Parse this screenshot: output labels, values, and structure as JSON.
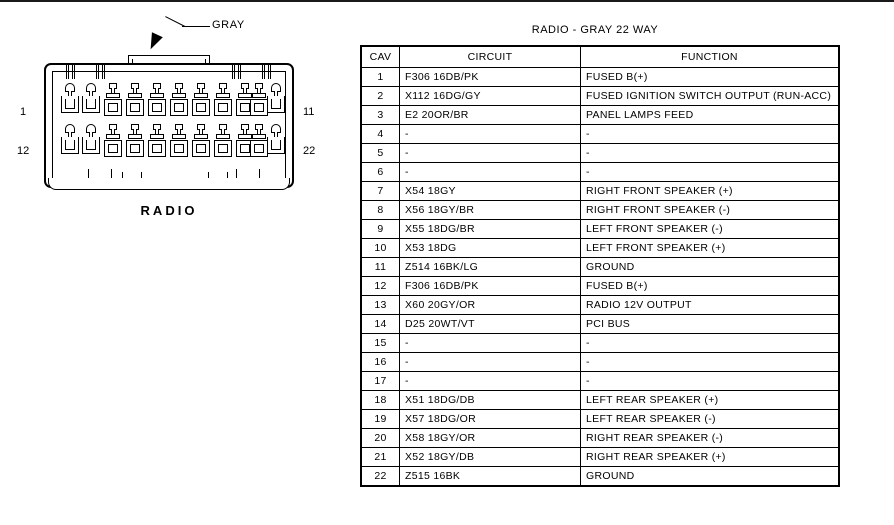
{
  "diagram": {
    "callout_label": "GRAY",
    "component_label": "RADIO",
    "pin_numbers": {
      "top_left": "1",
      "top_right": "11",
      "bottom_left": "12",
      "bottom_right": "22"
    },
    "cavity_count_per_row": 11
  },
  "table": {
    "title": "RADIO - GRAY 22 WAY",
    "columns": [
      "CAV",
      "CIRCUIT",
      "FUNCTION"
    ],
    "rows": [
      {
        "cav": "1",
        "circuit": "F306 16DB/PK",
        "function": "FUSED B(+)"
      },
      {
        "cav": "2",
        "circuit": "X112 16DG/GY",
        "function": "FUSED IGNITION SWITCH OUTPUT (RUN-ACC)"
      },
      {
        "cav": "3",
        "circuit": "E2 20OR/BR",
        "function": "PANEL LAMPS FEED"
      },
      {
        "cav": "4",
        "circuit": "-",
        "function": "-"
      },
      {
        "cav": "5",
        "circuit": "-",
        "function": "-"
      },
      {
        "cav": "6",
        "circuit": "-",
        "function": "-"
      },
      {
        "cav": "7",
        "circuit": "X54 18GY",
        "function": "RIGHT FRONT SPEAKER (+)"
      },
      {
        "cav": "8",
        "circuit": "X56 18GY/BR",
        "function": "RIGHT FRONT SPEAKER (-)"
      },
      {
        "cav": "9",
        "circuit": "X55 18DG/BR",
        "function": "LEFT FRONT SPEAKER (-)"
      },
      {
        "cav": "10",
        "circuit": "X53 18DG",
        "function": "LEFT FRONT SPEAKER (+)"
      },
      {
        "cav": "11",
        "circuit": "Z514 16BK/LG",
        "function": "GROUND"
      },
      {
        "cav": "12",
        "circuit": "F306 16DB/PK",
        "function": "FUSED B(+)"
      },
      {
        "cav": "13",
        "circuit": "X60 20GY/OR",
        "function": "RADIO 12V OUTPUT"
      },
      {
        "cav": "14",
        "circuit": "D25 20WT/VT",
        "function": "PCI BUS"
      },
      {
        "cav": "15",
        "circuit": "-",
        "function": "-"
      },
      {
        "cav": "16",
        "circuit": "-",
        "function": "-"
      },
      {
        "cav": "17",
        "circuit": "-",
        "function": "-"
      },
      {
        "cav": "18",
        "circuit": "X51 18DG/DB",
        "function": "LEFT REAR SPEAKER (+)"
      },
      {
        "cav": "19",
        "circuit": "X57 18DG/OR",
        "function": "LEFT REAR SPEAKER (-)"
      },
      {
        "cav": "20",
        "circuit": "X58 18GY/OR",
        "function": "RIGHT REAR SPEAKER (-)"
      },
      {
        "cav": "21",
        "circuit": "X52 18GY/DB",
        "function": "RIGHT REAR SPEAKER (+)"
      },
      {
        "cav": "22",
        "circuit": "Z515 16BK",
        "function": "GROUND"
      }
    ]
  }
}
